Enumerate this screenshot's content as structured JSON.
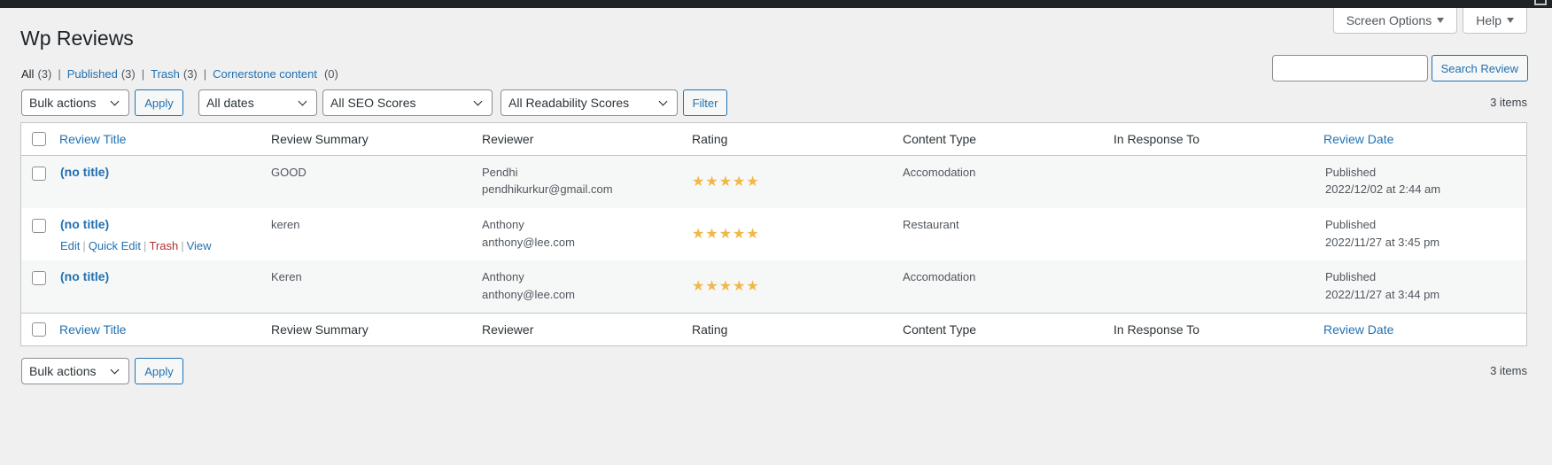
{
  "header": {
    "title": "Wp Reviews",
    "screen_options": "Screen Options",
    "help": "Help"
  },
  "views": [
    {
      "label": "All",
      "count": "(3)"
    },
    {
      "label": "Published",
      "count": "(3)"
    },
    {
      "label": "Trash",
      "count": "(3)"
    },
    {
      "label": "Cornerstone content",
      "count": "(0)"
    }
  ],
  "search": {
    "button": "Search Review",
    "value": ""
  },
  "filters": {
    "bulk_actions": "Bulk actions",
    "apply": "Apply",
    "dates": "All dates",
    "seo": "All SEO Scores",
    "readability": "All Readability Scores",
    "filter": "Filter"
  },
  "items_count": "3 items",
  "columns": {
    "title": "Review Title",
    "summary": "Review Summary",
    "reviewer": "Reviewer",
    "rating": "Rating",
    "content_type": "Content Type",
    "in_response_to": "In Response To",
    "date": "Review Date"
  },
  "rows": [
    {
      "title": "(no title)",
      "summary": "GOOD",
      "reviewer_name": "Pendhi",
      "reviewer_email": "pendhikurkur@gmail.com",
      "rating": 5,
      "stars": "★★★★★",
      "content_type": "Accomodation",
      "in_response_to": "",
      "status": "Published",
      "date": "2022/12/02 at 2:44 am"
    },
    {
      "title": "(no title)",
      "summary": "keren",
      "reviewer_name": "Anthony",
      "reviewer_email": "anthony@lee.com",
      "rating": 5,
      "stars": "★★★★★",
      "content_type": "Restaurant",
      "in_response_to": "",
      "status": "Published",
      "date": "2022/11/27 at 3:45 pm",
      "row_actions": {
        "edit": "Edit",
        "quick_edit": "Quick Edit",
        "trash": "Trash",
        "view": "View"
      }
    },
    {
      "title": "(no title)",
      "summary": "Keren",
      "reviewer_name": "Anthony",
      "reviewer_email": "anthony@lee.com",
      "rating": 5,
      "stars": "★★★★★",
      "content_type": "Accomodation",
      "in_response_to": "",
      "status": "Published",
      "date": "2022/11/27 at 3:44 pm"
    }
  ],
  "colors": {
    "accent": "#2271b1",
    "star": "#f0b849",
    "trash": "#b32d2e",
    "background": "#f0f0f1"
  }
}
